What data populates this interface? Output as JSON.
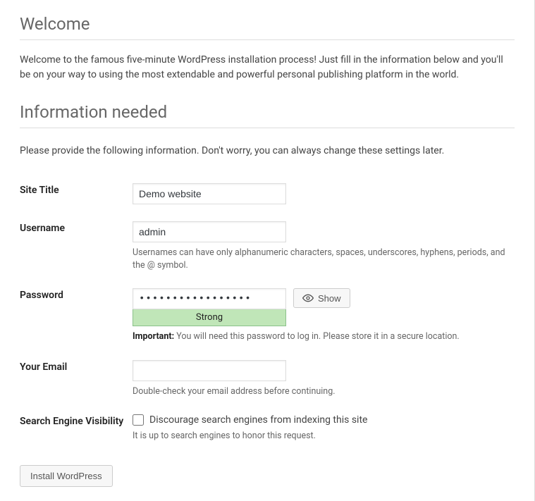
{
  "headings": {
    "welcome": "Welcome",
    "info_needed": "Information needed"
  },
  "intro_text": "Welcome to the famous five-minute WordPress installation process! Just fill in the information below and you'll be on your way to using the most extendable and powerful personal publishing platform in the world.",
  "sub_text": "Please provide the following information. Don't worry, you can always change these settings later.",
  "form": {
    "site_title": {
      "label": "Site Title",
      "value": "Demo website"
    },
    "username": {
      "label": "Username",
      "value": "admin",
      "hint": "Usernames can have only alphanumeric characters, spaces, underscores, hyphens, periods, and the @ symbol."
    },
    "password": {
      "label": "Password",
      "value": "•••••••••••••••••",
      "strength": "Strong",
      "show_button": "Show",
      "important_label": "Important:",
      "important_text": " You will need this password to log in. Please store it in a secure location."
    },
    "email": {
      "label": "Your Email",
      "value": "",
      "hint": "Double-check your email address before continuing."
    },
    "search_engine": {
      "label": "Search Engine Visibility",
      "checkbox_label": "Discourage search engines from indexing this site",
      "hint": "It is up to search engines to honor this request."
    }
  },
  "install_button": "Install WordPress"
}
